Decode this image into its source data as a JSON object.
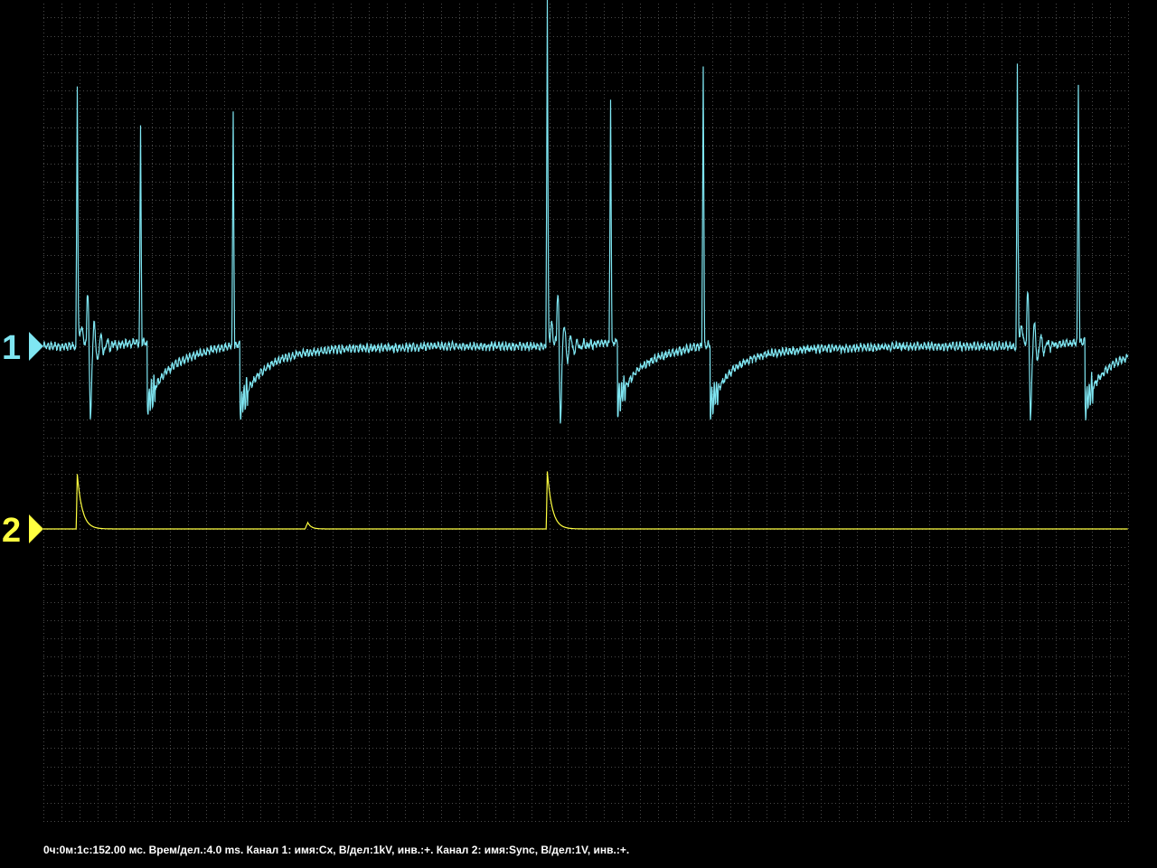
{
  "chart_data": {
    "type": "line",
    "grid": true,
    "x_unit": "ms",
    "x_range": [
      0,
      48
    ],
    "time_per_div_ms": 4.0,
    "horizontal_divisions": 12,
    "vertical_divisions": 9,
    "background_color": "#000000",
    "grid_color": "#4a4a4a",
    "series": [
      {
        "marker": "1",
        "name": "Cx",
        "volts_per_div": "1kV",
        "color": "#7fe6f2",
        "baseline_div": 5.0,
        "coil_events_ms": [
          1.5,
          22.3,
          43.1
        ],
        "spark_events_ms": [
          4.6,
          8.7,
          25.4,
          29.5,
          46.1
        ],
        "peak_div": [
          2.85,
          2.35,
          2.55,
          3.8,
          2.7,
          3.1,
          3.05
        ]
      },
      {
        "marker": "2",
        "name": "Sync",
        "volts_per_div": "1V",
        "color": "#ffff40",
        "baseline_div": 3.0,
        "pulses_ms": [
          1.5,
          22.3
        ],
        "pulse_height_div": [
          0.6,
          0.63
        ],
        "small_pulse_ms": [
          11.7
        ],
        "small_pulse_height_div": [
          0.07
        ]
      }
    ]
  },
  "status": {
    "text": "0ч:0м:1с:152.00 мс. Врем/дел.:4.0 ms. Канал 1: имя:Cx, В/дел:1kV, инв.:+. Канал 2: имя:Sync, В/дел:1V, инв.:+."
  }
}
